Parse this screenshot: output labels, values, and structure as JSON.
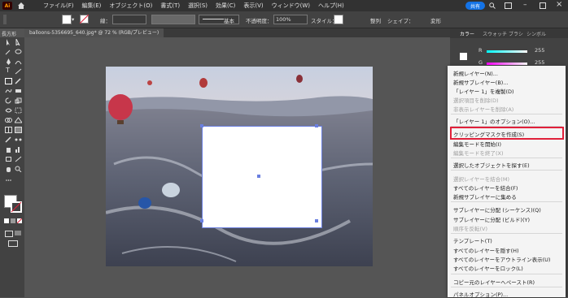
{
  "app": {
    "logo": "Ai",
    "share_label": "共有"
  },
  "menubar": {
    "items": [
      "ファイル(F)",
      "編集(E)",
      "オブジェクト(O)",
      "書式(T)",
      "選択(S)",
      "効果(C)",
      "表示(V)",
      "ウィンドウ(W)",
      "ヘルプ(H)"
    ]
  },
  "controlbar": {
    "stroke_label": "線：",
    "brush_label": "基本",
    "opacity_label": "不透明度：",
    "opacity_value": "100%",
    "style_label": "スタイル：",
    "align_label": "整列",
    "shape_label": "シェイプ：",
    "transform_label": "変形"
  },
  "tool_label": "長方形",
  "document_tab": "balloons-5356695_640.jpg* @ 72 % (RGB/プレビュー)",
  "panel": {
    "tabs": [
      "カラー",
      "スウォッチ",
      "ブラシ",
      "シンボル"
    ],
    "channel_r": "R",
    "channel_g": "G",
    "r_value": "255",
    "g_value": "255"
  },
  "context_menu": {
    "items": [
      {
        "label": "新規レイヤー(N)...",
        "enabled": true
      },
      {
        "label": "新規サブレイヤー(B)...",
        "enabled": true
      },
      {
        "label": "「レイヤー 1」を複製(D)",
        "enabled": true
      },
      {
        "label": "選択項目を削除(D)",
        "enabled": false
      },
      {
        "label": "非表示レイヤーを削除(A)",
        "enabled": false
      },
      {
        "label": "「レイヤー 1」のオプション(O)...",
        "enabled": true
      },
      {
        "label": "クリッピングマスクを作成(S)",
        "enabled": true,
        "highlighted": true
      },
      {
        "label": "編集モードを開始(I)",
        "enabled": true
      },
      {
        "label": "編集モードを終了(X)",
        "enabled": false
      },
      {
        "label": "選択したオブジェクトを探す(E)",
        "enabled": true
      },
      {
        "label": "選択レイヤーを結合(M)",
        "enabled": false
      },
      {
        "label": "すべてのレイヤーを結合(F)",
        "enabled": true
      },
      {
        "label": "新規サブレイヤーに集める",
        "enabled": true
      },
      {
        "label": "サブレイヤーに分配 (シーケンス)(Q)",
        "enabled": true
      },
      {
        "label": "サブレイヤーに分配 (ビルド)(Y)",
        "enabled": true
      },
      {
        "label": "順序を反転(V)",
        "enabled": false
      },
      {
        "label": "テンプレート(T)",
        "enabled": true
      },
      {
        "label": "すべてのレイヤーを隠す(H)",
        "enabled": true
      },
      {
        "label": "すべてのレイヤーをアウトライン表示(U)",
        "enabled": true
      },
      {
        "label": "すべてのレイヤーをロック(L)",
        "enabled": true
      },
      {
        "label": "コピー元のレイヤーへペースト(R)",
        "enabled": true
      },
      {
        "label": "パネルオプション(P)...",
        "enabled": true
      }
    ]
  },
  "colors": {
    "highlight_border": "#e0203a",
    "selection": "#6a7fe0",
    "share": "#1473e6"
  }
}
